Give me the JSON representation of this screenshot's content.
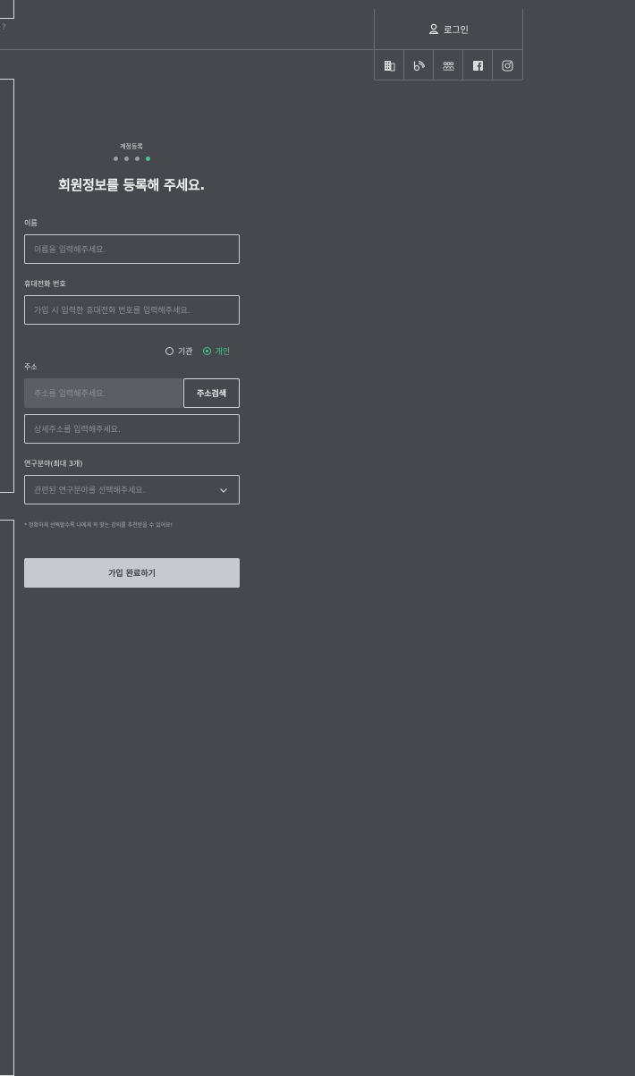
{
  "header": {
    "truncated_text": "?",
    "login_label": "로그인",
    "social_icons": [
      "building-icon",
      "blog-icon",
      "community-icon",
      "facebook-icon",
      "instagram-icon"
    ]
  },
  "form": {
    "step_label": "계정등록",
    "step_total": 4,
    "step_current": 4,
    "title": "회원정보를 등록해 주세요.",
    "name": {
      "label": "이름",
      "placeholder": "이름을 입력해주세요."
    },
    "phone": {
      "label": "휴대전화 번호",
      "placeholder": "가입 시 입력한 휴대전화 번호를 입력해주세요."
    },
    "member_type": {
      "options": [
        "기관",
        "개인"
      ],
      "selected": "개인"
    },
    "address": {
      "label": "주소",
      "placeholder": "주소를 입력해주세요.",
      "search_button": "주소검색",
      "detail_placeholder": "상세주소를 입력해주세요."
    },
    "research_field": {
      "label": "연구분야(최대 3개)",
      "placeholder": "관련된 연구분야를 선택해주세요."
    },
    "hint": "* 정확하게 선택할수록 나에게 꼭 맞는 강의를 추천받을 수 있어요!",
    "submit_label": "가입 완료하기"
  },
  "colors": {
    "background": "#45484c",
    "accent": "#4bc596",
    "submit_bg": "#c6c9cf"
  }
}
